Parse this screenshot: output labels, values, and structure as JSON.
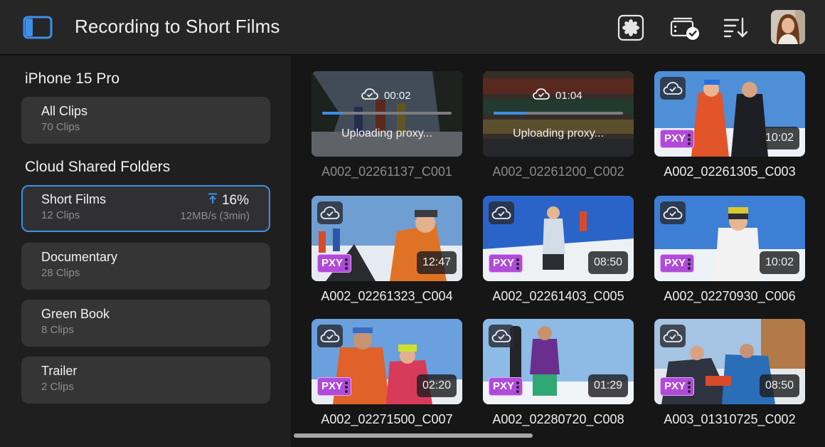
{
  "header": {
    "title": "Recording to Short Films",
    "icons": [
      "sidebar-toggle-icon",
      "aperture-icon",
      "clips-checked-icon",
      "sort-icon",
      "user-avatar"
    ]
  },
  "sidebar": {
    "device_heading": "iPhone 15 Pro",
    "all_clips": {
      "name": "All Clips",
      "count": "70 Clips"
    },
    "shared_heading": "Cloud Shared Folders",
    "folders": [
      {
        "name": "Short Films",
        "count": "12 Clips",
        "progress": "16%",
        "speed": "12MB/s (3min)",
        "selected": true
      },
      {
        "name": "Documentary",
        "count": "28 Clips"
      },
      {
        "name": "Green Book",
        "count": "8 Clips"
      },
      {
        "name": "Trailer",
        "count": "2 Clips"
      }
    ]
  },
  "clips": [
    {
      "name": "A002_02261137_C001",
      "uploading": true,
      "upload_time": "00:02",
      "upload_progress": 0.16,
      "upload_label": "Uploading proxy..."
    },
    {
      "name": "A002_02261200_C002",
      "uploading": true,
      "upload_time": "01:04",
      "upload_progress": 0.25,
      "upload_label": "Uploading proxy..."
    },
    {
      "name": "A002_02261305_C003",
      "duration": "10:02",
      "badge": "PXY"
    },
    {
      "name": "A002_02261323_C004",
      "duration": "12:47",
      "badge": "PXY"
    },
    {
      "name": "A002_02261403_C005",
      "duration": "08:50",
      "badge": "PXY"
    },
    {
      "name": "A002_02270930_C006",
      "duration": "10:02",
      "badge": "PXY"
    },
    {
      "name": "A002_02271500_C007",
      "duration": "02:20",
      "badge": "PXY"
    },
    {
      "name": "A002_02280720_C008",
      "duration": "01:29",
      "badge": "PXY"
    },
    {
      "name": "A003_01310725_C002",
      "duration": "08:50",
      "badge": "PXY"
    }
  ],
  "colors": {
    "accent": "#3d8fe6",
    "proxy_badge": "#b04ad8",
    "background": "#161616",
    "sidebar": "#1f1f20",
    "card": "#353536"
  }
}
